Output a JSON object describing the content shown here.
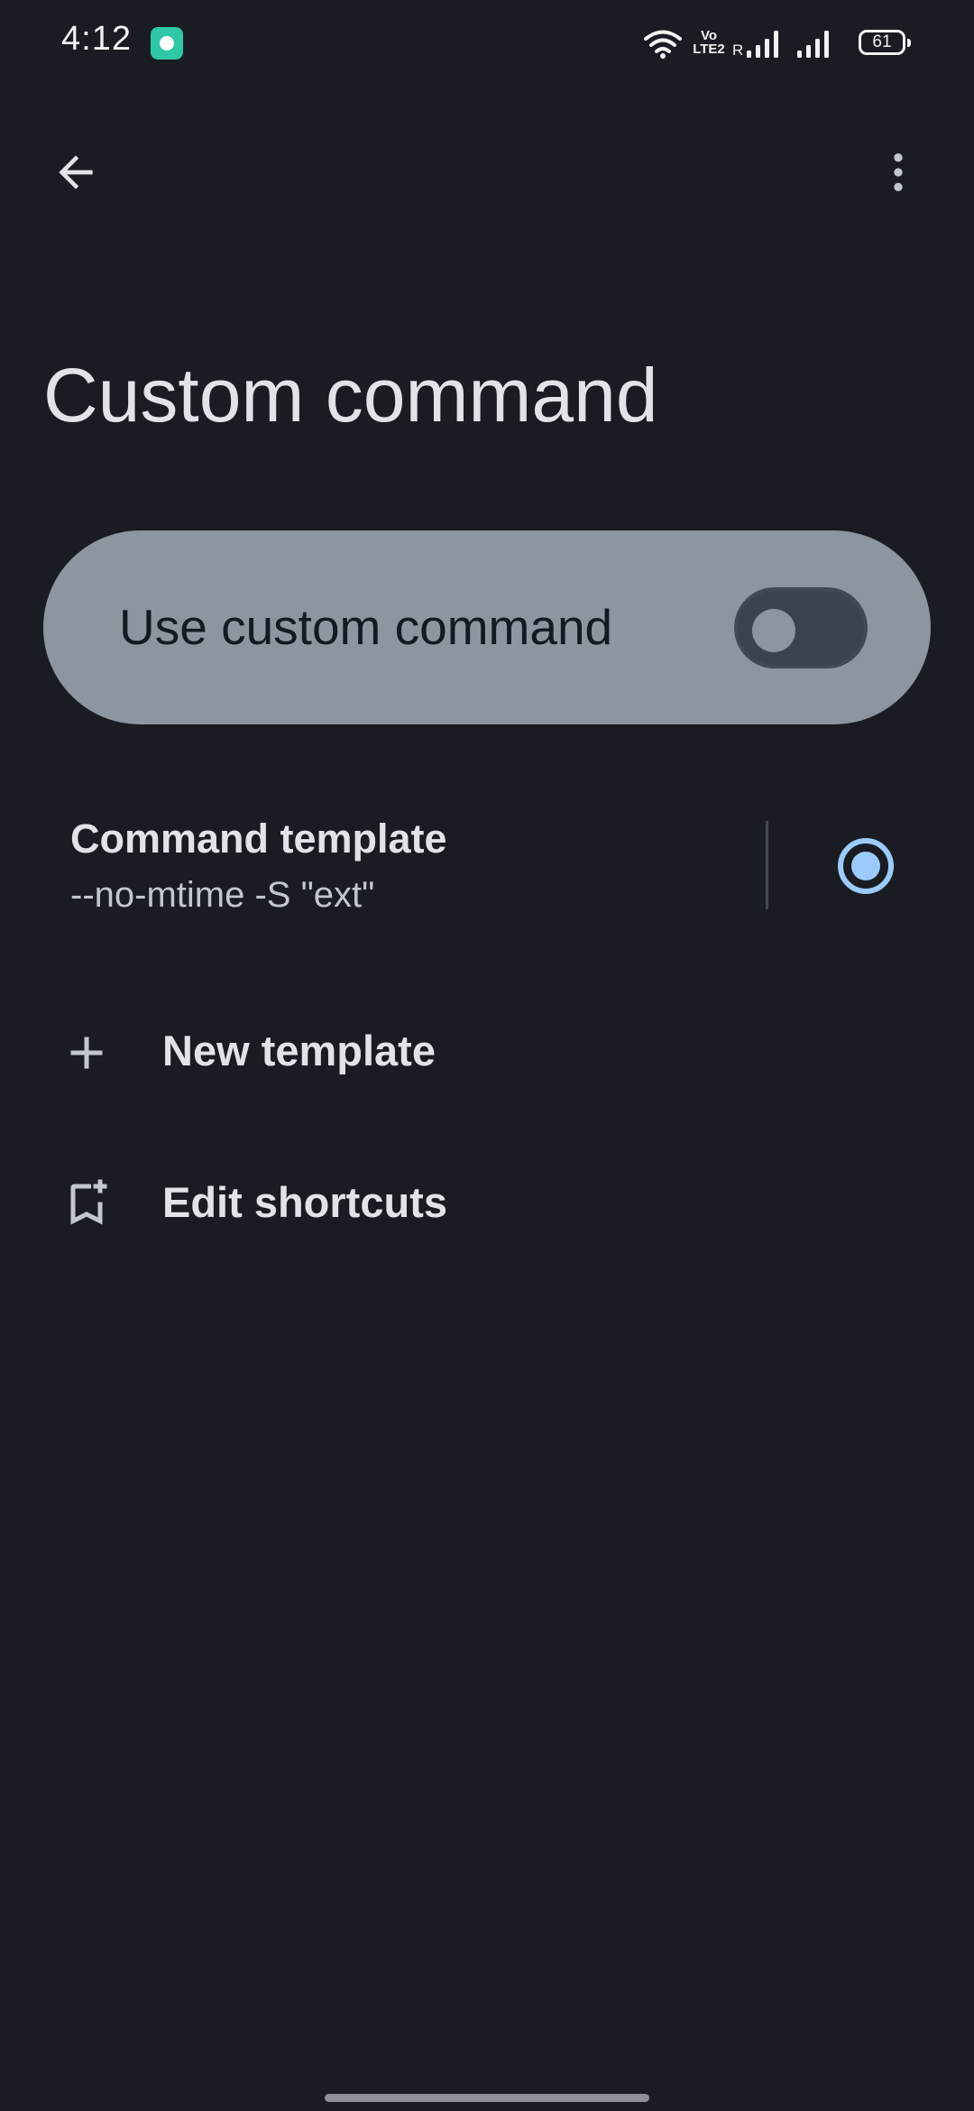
{
  "status_bar": {
    "time": "4:12",
    "network_label": "Vo LTE2",
    "roaming_label": "R",
    "battery_level": "61",
    "icons": [
      "notification-app-icon",
      "wifi-icon",
      "volte-icon",
      "signal-icon",
      "signal-icon",
      "battery-icon"
    ]
  },
  "app_bar": {
    "back_icon": "arrow-back-icon",
    "more_icon": "more-vert-icon"
  },
  "page": {
    "title": "Custom command"
  },
  "toggle_card": {
    "label": "Use custom command",
    "enabled": false
  },
  "template_item": {
    "title": "Command template",
    "subtitle": "--no-mtime -S \"ext\"",
    "selected": true
  },
  "actions": {
    "new_template": {
      "label": "New template",
      "icon": "add-icon"
    },
    "edit_shortcuts": {
      "label": "Edit shortcuts",
      "icon": "bookmark-add-icon"
    }
  },
  "colors": {
    "background": "#191c22",
    "card": "#8d95a0",
    "accent": "#9ccbfb",
    "text_primary": "#e2e2e9",
    "text_secondary": "#c2c7cf"
  }
}
